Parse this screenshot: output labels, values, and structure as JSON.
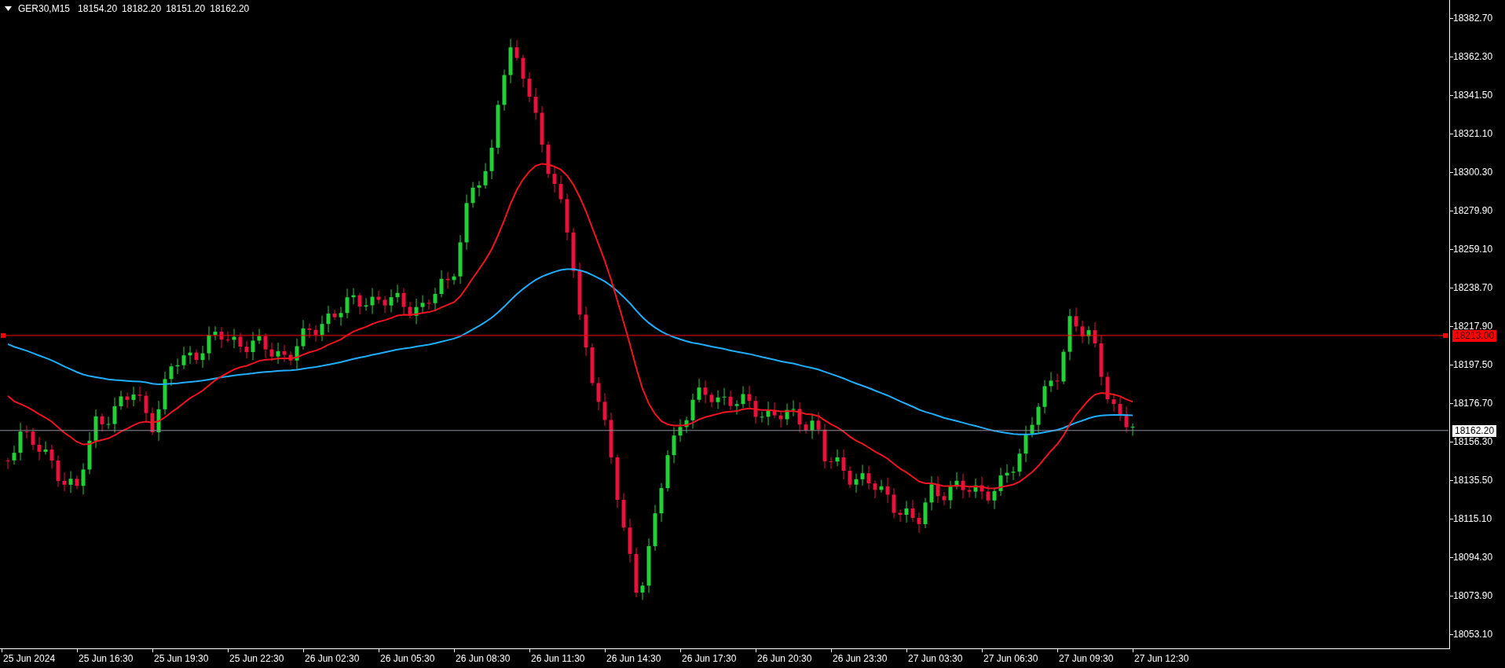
{
  "header": {
    "symbol": "GER30,M15",
    "values": [
      "18154.20",
      "18182.20",
      "18151.20",
      "18162.20"
    ]
  },
  "price_axis": {
    "ticks": [
      "18382.70",
      "18362.30",
      "18341.50",
      "18321.10",
      "18300.30",
      "18279.90",
      "18259.10",
      "18238.70",
      "18217.90",
      "18197.50",
      "18176.70",
      "18156.30",
      "18135.50",
      "18115.10",
      "18094.30",
      "18073.90",
      "18053.10"
    ]
  },
  "levels": [
    {
      "kind": "alert",
      "label": "18213.00"
    },
    {
      "kind": "current",
      "label": "18162.20"
    }
  ],
  "time_axis": {
    "labels": [
      "25 Jun 2024",
      "25 Jun 16:30",
      "25 Jun 19:30",
      "25 Jun 22:30",
      "26 Jun 02:30",
      "26 Jun 05:30",
      "26 Jun 08:30",
      "26 Jun 11:30",
      "26 Jun 14:30",
      "26 Jun 17:30",
      "26 Jun 20:30",
      "26 Jun 23:30",
      "27 Jun 03:30",
      "27 Jun 06:30",
      "27 Jun 09:30",
      "27 Jun 12:30"
    ]
  }
}
